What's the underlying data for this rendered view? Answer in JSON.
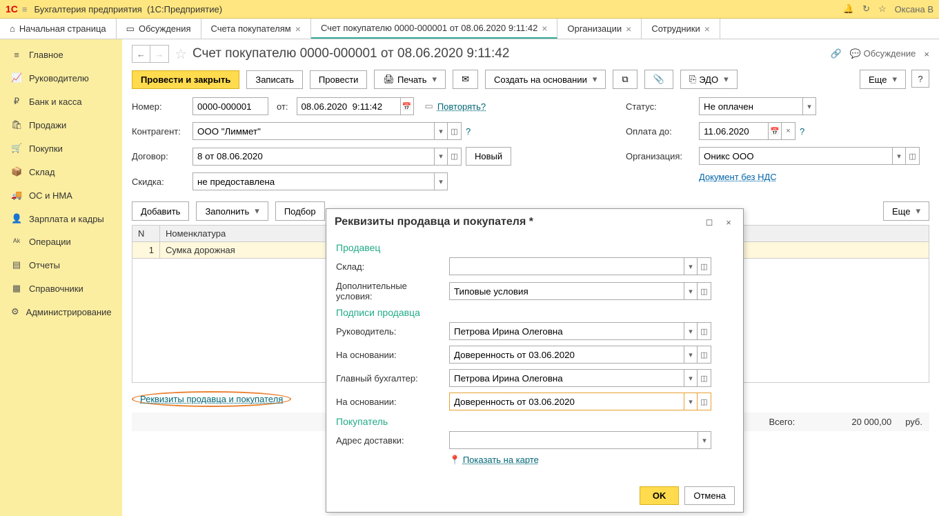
{
  "titlebar": {
    "app_name": "Бухгалтерия предприятия",
    "suffix": "(1С:Предприятие)",
    "user": "Оксана В"
  },
  "tabs": [
    {
      "label": "Начальная страница",
      "closable": false
    },
    {
      "label": "Обсуждения",
      "closable": false
    },
    {
      "label": "Счета покупателям",
      "closable": true
    },
    {
      "label": "Счет покупателю 0000-000001 от 08.06.2020 9:11:42",
      "closable": true,
      "active": true
    },
    {
      "label": "Организации",
      "closable": true
    },
    {
      "label": "Сотрудники",
      "closable": true
    }
  ],
  "sidebar": [
    {
      "icon": "≡",
      "label": "Главное"
    },
    {
      "icon": "📈",
      "label": "Руководителю"
    },
    {
      "icon": "₽",
      "label": "Банк и касса"
    },
    {
      "icon": "🛍",
      "label": "Продажи"
    },
    {
      "icon": "🛒",
      "label": "Покупки"
    },
    {
      "icon": "📦",
      "label": "Склад"
    },
    {
      "icon": "🚚",
      "label": "ОС и НМА"
    },
    {
      "icon": "👤",
      "label": "Зарплата и кадры"
    },
    {
      "icon": "ᴬᵏ",
      "label": "Операции"
    },
    {
      "icon": "▤",
      "label": "Отчеты"
    },
    {
      "icon": "▦",
      "label": "Справочники"
    },
    {
      "icon": "⚙",
      "label": "Администрирование"
    }
  ],
  "doc": {
    "title": "Счет покупателю 0000-000001 от 08.06.2020 9:11:42",
    "discussion": "Обсуждение"
  },
  "toolbar": {
    "post_close": "Провести и закрыть",
    "save": "Записать",
    "post": "Провести",
    "print": "Печать",
    "create_based": "Создать на основании",
    "edo": "ЭДО",
    "more": "Еще"
  },
  "form": {
    "number_label": "Номер:",
    "number": "0000-000001",
    "from_label": "от:",
    "date": "08.06.2020  9:11:42",
    "repeat": "Повторять?",
    "status_label": "Статус:",
    "status": "Не оплачен",
    "counterparty_label": "Контрагент:",
    "counterparty": "ООО \"Лиммет\"",
    "payuntil_label": "Оплата до:",
    "payuntil": "11.06.2020",
    "contract_label": "Договор:",
    "contract": "8 от 08.06.2020",
    "new_btn": "Новый",
    "org_label": "Организация:",
    "org": "Оникс ООО",
    "discount_label": "Скидка:",
    "discount": "не предоставлена",
    "vat_link": "Документ без НДС"
  },
  "table_toolbar": {
    "add": "Добавить",
    "fill": "Заполнить",
    "select": "Подбор",
    "more": "Еще"
  },
  "table": {
    "col_n": "N",
    "col_nom": "Номенклатура",
    "rows": [
      {
        "n": "1",
        "nom": "Сумка дорожная"
      }
    ]
  },
  "footer": {
    "req_link": "Реквизиты продавца и покупателя",
    "total_label": "Всего:",
    "total_value": "20 000,00",
    "cur": "руб."
  },
  "popup": {
    "title": "Реквизиты продавца и покупателя *",
    "seller": "Продавец",
    "warehouse_label": "Склад:",
    "warehouse": "",
    "addterms_label": "Дополнительные условия:",
    "addterms": "Типовые условия",
    "signatures": "Подписи продавца",
    "head_label": "Руководитель:",
    "head": "Петрова Ирина Олеговна",
    "based1_label": "На основании:",
    "based1": "Доверенность от 03.06.2020",
    "acct_label": "Главный бухгалтер:",
    "acct": "Петрова Ирина Олеговна",
    "based2_label": "На основании:",
    "based2": "Доверенность от 03.06.2020",
    "buyer": "Покупатель",
    "addr_label": "Адрес доставки:",
    "addr": "",
    "map_link": "Показать на карте",
    "ok": "OK",
    "cancel": "Отмена"
  }
}
